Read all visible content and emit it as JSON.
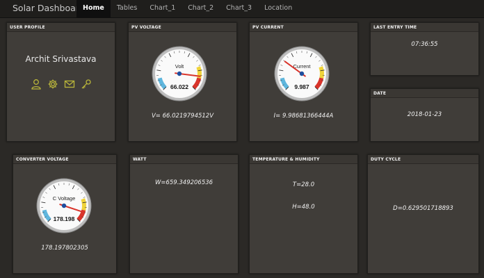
{
  "nav": {
    "brand": "Solar Dashboard",
    "items": [
      {
        "label": "Home",
        "active": true
      },
      {
        "label": "Tables",
        "active": false
      },
      {
        "label": "Chart_1",
        "active": false
      },
      {
        "label": "Chart_2",
        "active": false
      },
      {
        "label": "Chart_3",
        "active": false
      },
      {
        "label": "Location",
        "active": false
      }
    ]
  },
  "user_profile": {
    "title": "USER PROFILE",
    "name": "Archit Srivastava",
    "icons": [
      "user-icon",
      "gear-icon",
      "mail-icon",
      "key-icon"
    ],
    "icon_color": "#b9b53a"
  },
  "pv_voltage": {
    "title": "PV VOLTAGE",
    "gauge_label": "Volt",
    "gauge_reading": "66.022",
    "gauge_value": 66.022,
    "gauge_min": -20,
    "gauge_max": 80,
    "text": "V= 66.0219794512V"
  },
  "pv_current": {
    "title": "PV CURRENT",
    "gauge_label": "Current",
    "gauge_reading": "9.987",
    "gauge_value": 9.987,
    "gauge_min": -20,
    "gauge_max": 80,
    "text": "I= 9.98681366444A"
  },
  "last_entry": {
    "title": "LAST ENTRY TIME",
    "value": "07:36:55"
  },
  "date": {
    "title": "DATE",
    "value": "2018-01-23"
  },
  "converter_voltage": {
    "title": "CONVERTER VOLTAGE",
    "gauge_label": "C Voltage",
    "gauge_reading": "178.198",
    "gauge_value": 178.198,
    "gauge_min": -20,
    "gauge_max": 200,
    "text": "178.197802305"
  },
  "watt": {
    "title": "WATT",
    "value": "W=659.349206536"
  },
  "temp_humidity": {
    "title": "TEMPERATURE & HUMIDITY",
    "temperature": "T=28.0",
    "humidity": "H=48.0"
  },
  "duty_cycle": {
    "title": "DUTY CYCLE",
    "value": "D=0.629501718893"
  },
  "colors": {
    "background": "#2b2926",
    "panel": "#403d39",
    "gauge_blue": "#5fb6dd",
    "gauge_yellow": "#f0d43a",
    "gauge_red": "#d9342b",
    "needle": "#1f4f9f"
  }
}
